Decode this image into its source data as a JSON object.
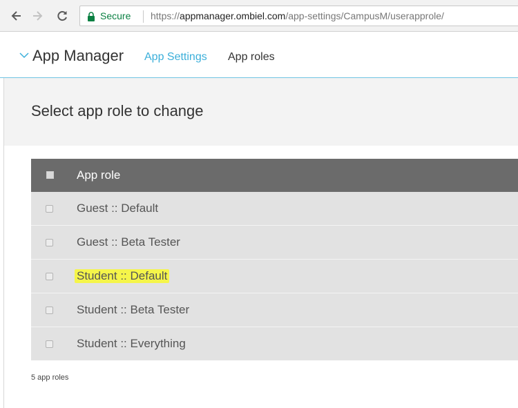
{
  "browser": {
    "secure_label": "Secure",
    "url_scheme": "https://",
    "url_host": "appmanager.ombiel.com",
    "url_path": "/app-settings/CampusM/userapprole/"
  },
  "header": {
    "title": "App Manager",
    "breadcrumb_settings": "App Settings",
    "breadcrumb_current": "App roles"
  },
  "main": {
    "heading": "Select app role to change",
    "table": {
      "column_header": "App role",
      "rows": [
        {
          "label": "Guest :: Default"
        },
        {
          "label": "Guest :: Beta Tester"
        },
        {
          "label": "Student :: Default",
          "highlighted": true
        },
        {
          "label": "Student :: Beta Tester"
        },
        {
          "label": "Student :: Everything"
        }
      ]
    },
    "count_text": "5 app roles"
  },
  "colors": {
    "link": "#3bafda",
    "table_header": "#6b6b6b",
    "row_bg": "#e2e2e2",
    "highlight": "#f5f54a",
    "secure_green": "#0b8043"
  }
}
